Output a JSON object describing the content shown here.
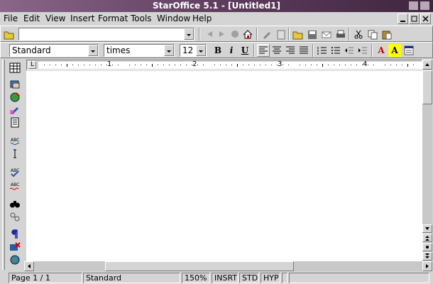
{
  "window": {
    "title": "StarOffice 5.1 - [Untitled1]"
  },
  "menu": [
    "File",
    "Edit",
    "View",
    "Insert",
    "Format",
    "Tools",
    "Window",
    "Help"
  ],
  "url_field": {
    "value": ""
  },
  "format": {
    "paragraph_style": "Standard",
    "font_name": "times",
    "font_size": "12",
    "bold": "B",
    "italic": "i",
    "underline": "U",
    "font_color": "A",
    "highlight": "A"
  },
  "ruler": {
    "numbers": [
      "1",
      "2",
      "3",
      "4"
    ]
  },
  "status": {
    "page": "Page 1 / 1",
    "style": "Standard",
    "zoom": "150%",
    "insert_mode": "INSRT",
    "selection_mode": "STD",
    "hyperlink_mode": "HYP"
  },
  "colors": {
    "title_start": "#8a6789",
    "title_end": "#3f263f",
    "chrome": "#d4d4d4",
    "font_color": "#cc0000",
    "highlight": "#ffff00"
  }
}
